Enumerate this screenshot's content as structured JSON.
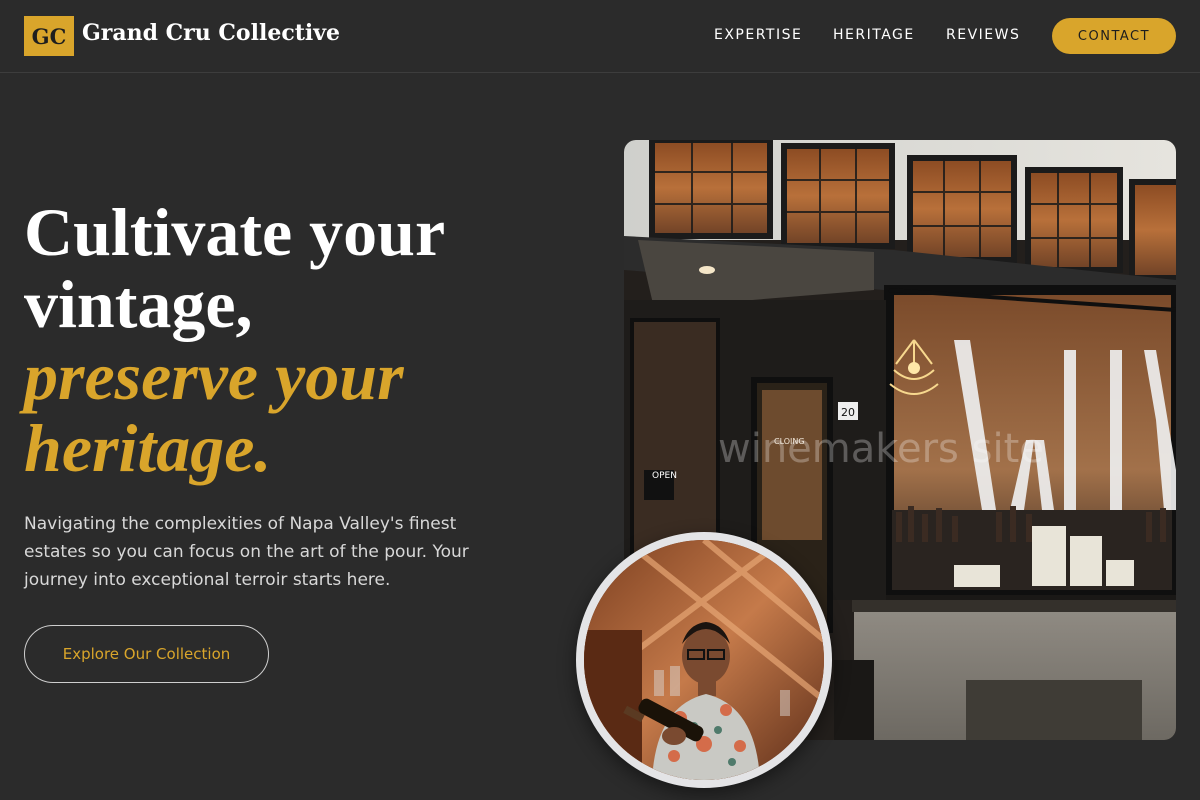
{
  "header": {
    "logo_mark": "GC",
    "brand_name": "Grand Cru Collective",
    "nav": [
      {
        "label": "EXPERTISE"
      },
      {
        "label": "HERITAGE"
      },
      {
        "label": "REVIEWS"
      }
    ],
    "contact_label": "CONTACT"
  },
  "hero": {
    "title_line1": "Cultivate your",
    "title_line2": "vintage,",
    "title_accent_line1": "preserve your",
    "title_accent_line2": "heritage.",
    "description": "Navigating the complexities of Napa Valley's finest estates so you can focus on the art of the pour. Your journey into exceptional terroir starts here.",
    "cta_label": "Explore Our Collection"
  },
  "images": {
    "storefront": {
      "window_lettering": "WIJN",
      "watermark": "winemakers site",
      "door_number": "20",
      "open_sign": "OPEN",
      "door_sign": "CLOING"
    },
    "portrait": {}
  },
  "colors": {
    "background": "#2b2b2b",
    "accent": "#d9a52b",
    "text": "#ffffff",
    "muted_text": "#d8d8d8"
  }
}
